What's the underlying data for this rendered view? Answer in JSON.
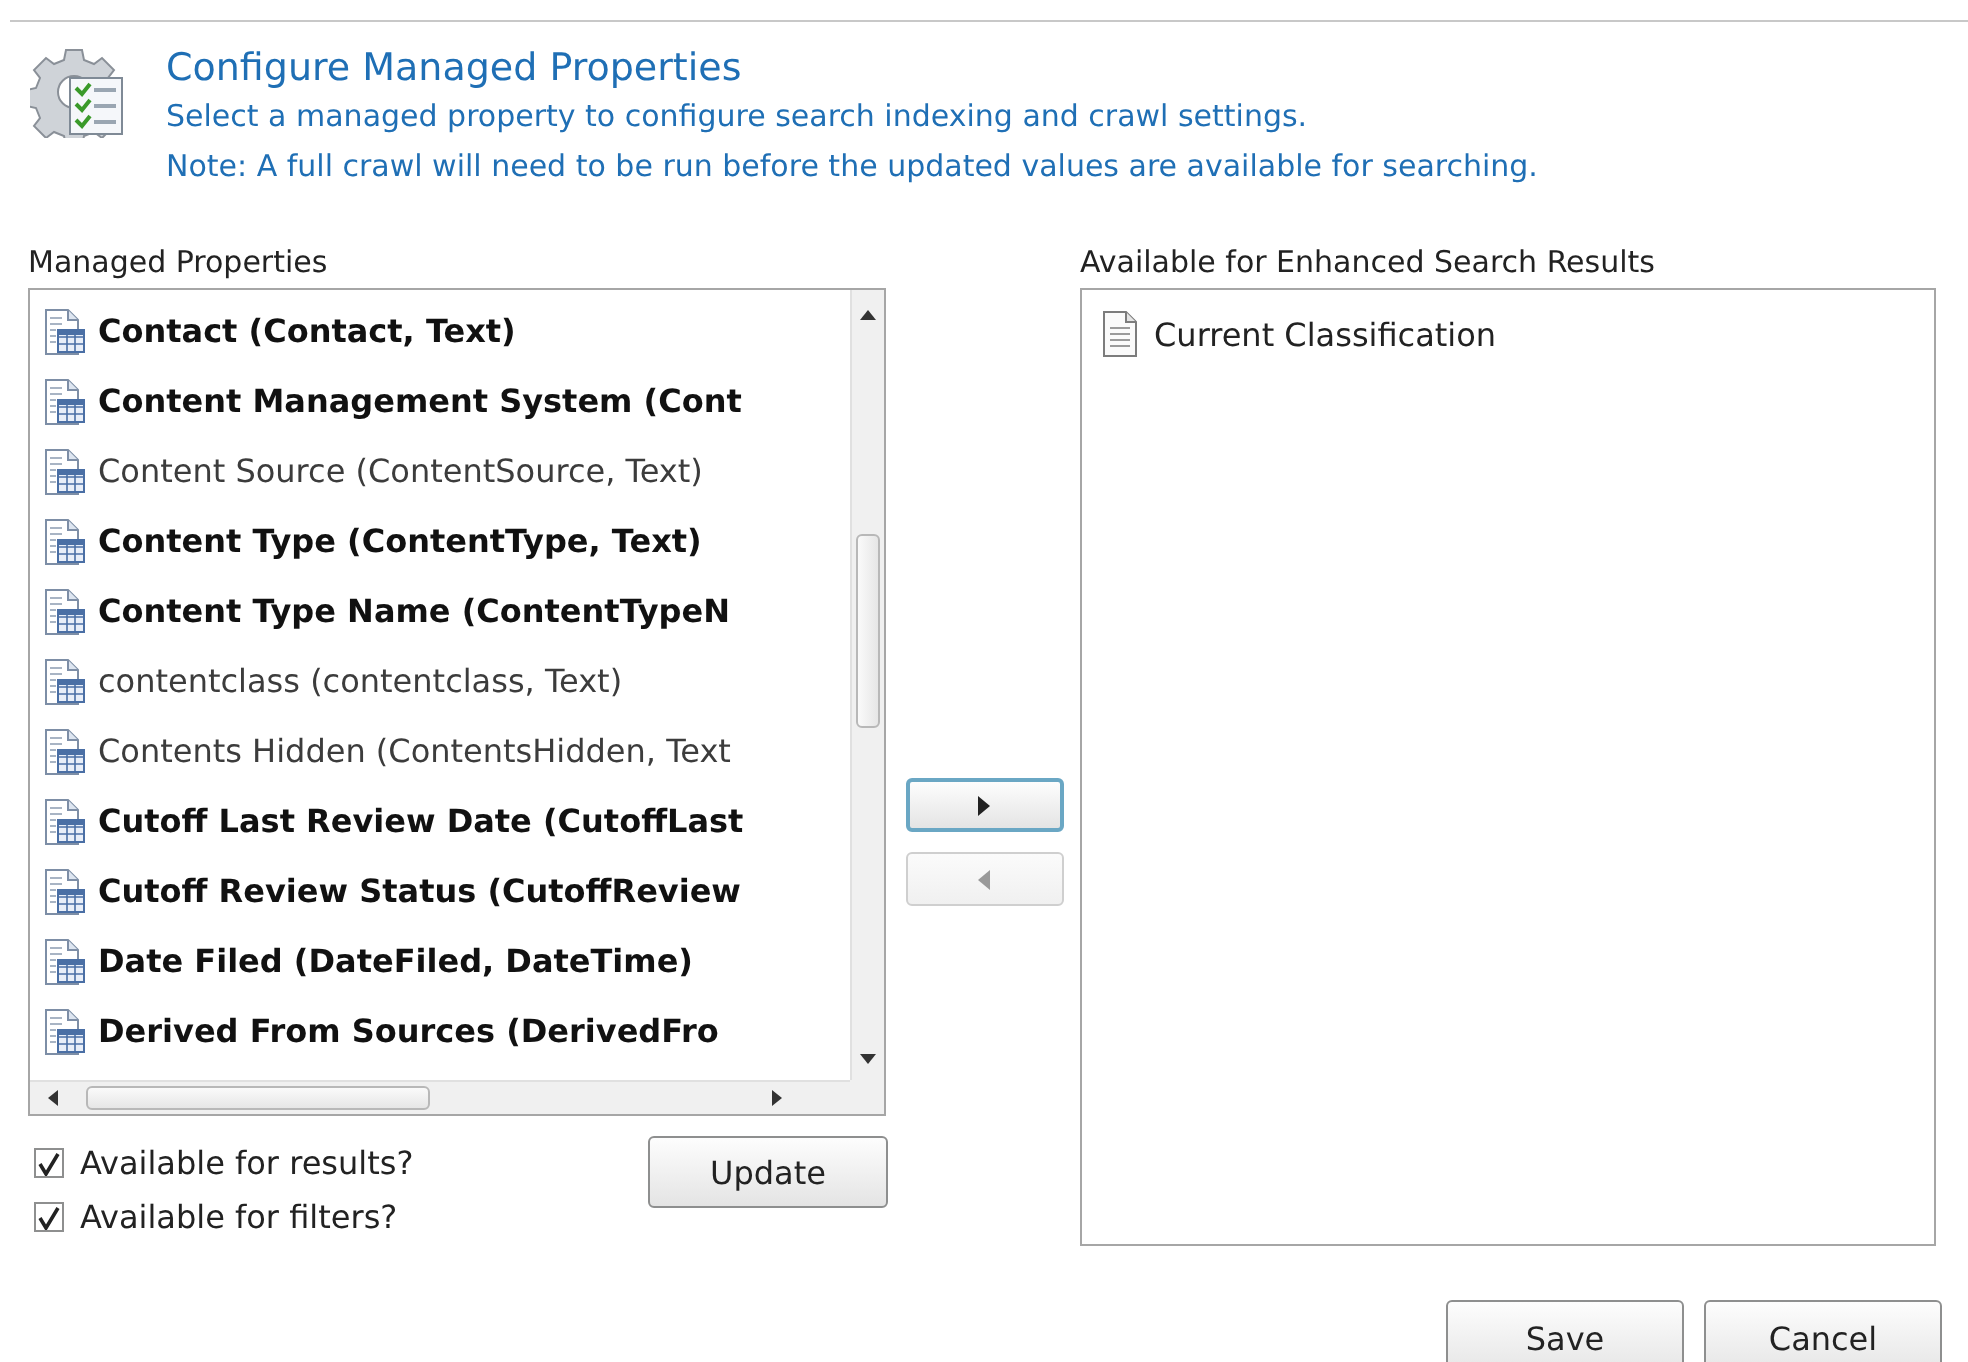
{
  "header": {
    "title": "Configure Managed Properties",
    "description": "Select a managed property to configure search indexing and crawl settings.",
    "note": "Note: A full crawl will need to be run before the updated values are available for searching."
  },
  "managed_properties": {
    "label": "Managed Properties",
    "items": [
      {
        "text": "Contact (Contact, Text)",
        "bold": true
      },
      {
        "text": "Content Management System (Cont",
        "bold": true
      },
      {
        "text": "Content Source (ContentSource, Text)",
        "bold": false
      },
      {
        "text": "Content Type (ContentType, Text)",
        "bold": true
      },
      {
        "text": "Content Type Name (ContentTypeN",
        "bold": true
      },
      {
        "text": "contentclass (contentclass, Text)",
        "bold": false
      },
      {
        "text": "Contents Hidden (ContentsHidden, Text",
        "bold": false
      },
      {
        "text": "Cutoff Last Review Date (CutoffLast",
        "bold": true
      },
      {
        "text": "Cutoff Review Status (CutoffReview",
        "bold": true
      },
      {
        "text": "Date Filed (DateFiled, DateTime)",
        "bold": true
      },
      {
        "text": "Derived From Sources (DerivedFro",
        "bold": true
      }
    ]
  },
  "move_buttons": [
    {
      "kind": "add",
      "disabled": false
    },
    {
      "kind": "remove",
      "disabled": true
    }
  ],
  "options": [
    {
      "label": "Available for results?",
      "checked": true
    },
    {
      "label": "Available for filters?",
      "checked": true
    }
  ],
  "update_button": "Update",
  "enhanced": {
    "label": "Available for Enhanced Search Results",
    "items": [
      "Current Classification"
    ]
  },
  "buttons": [
    "Save",
    "Cancel"
  ]
}
